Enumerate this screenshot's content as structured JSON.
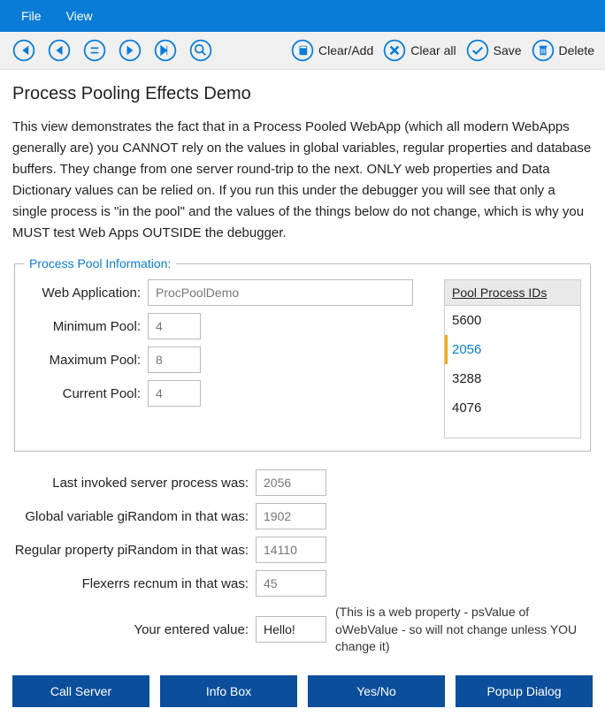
{
  "menubar": {
    "file": "File",
    "view": "View"
  },
  "toolbar": {
    "clear_add": "Clear/Add",
    "clear_all": "Clear all",
    "save": "Save",
    "delete": "Delete"
  },
  "page": {
    "title": "Process Pooling Effects Demo",
    "intro": "This view demonstrates the fact that in a Process Pooled WebApp (which all modern WebApps generally are) you CANNOT rely on the values in global variables, regular properties and database buffers. They change from one server round-trip to the next. ONLY web properties and Data Dictionary values can be relied on. If you run this under the debugger you will see that only a single process is \"in the pool\" and the values of the things below do not change, which is why you MUST test Web Apps OUTSIDE the debugger."
  },
  "pool_info": {
    "legend": "Process Pool Information:",
    "web_app_label": "Web Application:",
    "web_app_value": "ProcPoolDemo",
    "min_pool_label": "Minimum Pool:",
    "min_pool_value": "4",
    "max_pool_label": "Maximum Pool:",
    "max_pool_value": "8",
    "cur_pool_label": "Current Pool:",
    "cur_pool_value": "4",
    "list_header": "Pool Process IDs",
    "ids": [
      "5600",
      "2056",
      "3288",
      "4076"
    ],
    "selected_index": 1
  },
  "lower": {
    "last_proc_label": "Last invoked server process was:",
    "last_proc_value": "2056",
    "gi_random_label": "Global variable giRandom in that was:",
    "gi_random_value": "1902",
    "pi_random_label": "Regular property piRandom in that was:",
    "pi_random_value": "14110",
    "flexerrs_label": "Flexerrs recnum in that was:",
    "flexerrs_value": "45",
    "entered_label": "Your entered value:",
    "entered_value": "Hello!",
    "entered_note": "(This is a web property - psValue of oWebValue - so will not change unless YOU change it)"
  },
  "buttons": {
    "call_server": "Call Server",
    "info_box": "Info Box",
    "yes_no": "Yes/No",
    "popup": "Popup Dialog"
  }
}
